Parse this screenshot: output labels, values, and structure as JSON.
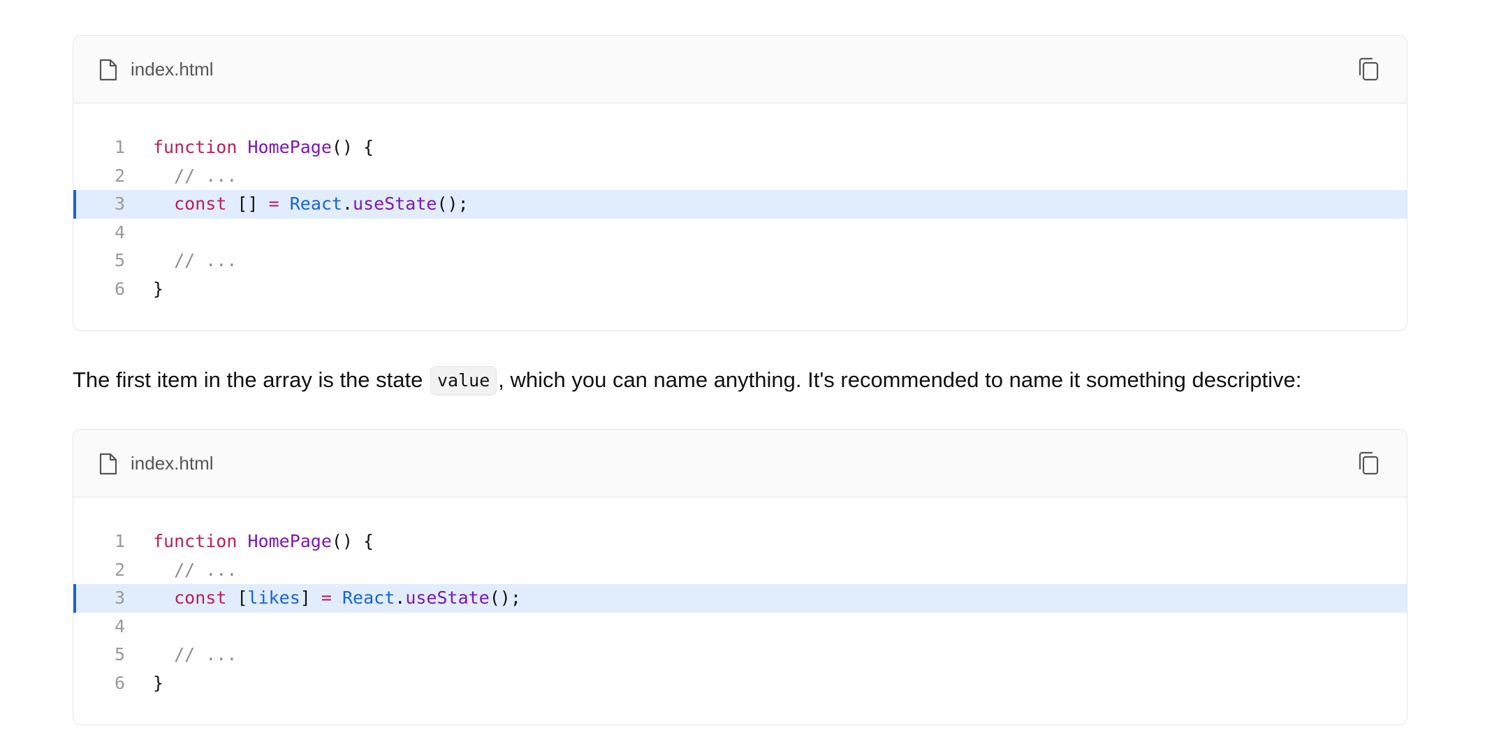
{
  "code_blocks": [
    {
      "filename": "index.html",
      "highlighted_line": 3,
      "lines": [
        {
          "num": "1",
          "tokens": [
            {
              "t": "function",
              "c": "kw"
            },
            {
              "t": " ",
              "c": "p"
            },
            {
              "t": "HomePage",
              "c": "fn"
            },
            {
              "t": "() {",
              "c": "p"
            }
          ]
        },
        {
          "num": "2",
          "tokens": [
            {
              "t": "  // ...",
              "c": "cm"
            }
          ]
        },
        {
          "num": "3",
          "tokens": [
            {
              "t": "  ",
              "c": "p"
            },
            {
              "t": "const",
              "c": "kw"
            },
            {
              "t": " [] ",
              "c": "p"
            },
            {
              "t": "=",
              "c": "kw"
            },
            {
              "t": " ",
              "c": "p"
            },
            {
              "t": "React",
              "c": "var"
            },
            {
              "t": ".",
              "c": "p"
            },
            {
              "t": "useState",
              "c": "fn"
            },
            {
              "t": "();",
              "c": "p"
            }
          ]
        },
        {
          "num": "4",
          "tokens": []
        },
        {
          "num": "5",
          "tokens": [
            {
              "t": "  // ...",
              "c": "cm"
            }
          ]
        },
        {
          "num": "6",
          "tokens": [
            {
              "t": "}",
              "c": "p"
            }
          ]
        }
      ]
    },
    {
      "filename": "index.html",
      "highlighted_line": 3,
      "lines": [
        {
          "num": "1",
          "tokens": [
            {
              "t": "function",
              "c": "kw"
            },
            {
              "t": " ",
              "c": "p"
            },
            {
              "t": "HomePage",
              "c": "fn"
            },
            {
              "t": "() {",
              "c": "p"
            }
          ]
        },
        {
          "num": "2",
          "tokens": [
            {
              "t": "  // ...",
              "c": "cm"
            }
          ]
        },
        {
          "num": "3",
          "tokens": [
            {
              "t": "  ",
              "c": "p"
            },
            {
              "t": "const",
              "c": "kw"
            },
            {
              "t": " [",
              "c": "p"
            },
            {
              "t": "likes",
              "c": "var"
            },
            {
              "t": "] ",
              "c": "p"
            },
            {
              "t": "=",
              "c": "kw"
            },
            {
              "t": " ",
              "c": "p"
            },
            {
              "t": "React",
              "c": "var"
            },
            {
              "t": ".",
              "c": "p"
            },
            {
              "t": "useState",
              "c": "fn"
            },
            {
              "t": "();",
              "c": "p"
            }
          ]
        },
        {
          "num": "4",
          "tokens": []
        },
        {
          "num": "5",
          "tokens": [
            {
              "t": "  // ...",
              "c": "cm"
            }
          ]
        },
        {
          "num": "6",
          "tokens": [
            {
              "t": "}",
              "c": "p"
            }
          ]
        }
      ]
    }
  ],
  "paragraph": {
    "before": "The first item in the array is the state ",
    "code": "value",
    "after": ", which you can name anything. It's recommended to name it something descriptive:"
  },
  "icons": {
    "file": "file-icon",
    "copy": "copy-icon"
  },
  "colors": {
    "keyword": "#b81f5f",
    "function": "#7a17b8",
    "variable": "#1663d6",
    "comment": "#8c8c8c",
    "highlight_bg": "#e1edfc",
    "highlight_bar": "#1a64d8"
  }
}
